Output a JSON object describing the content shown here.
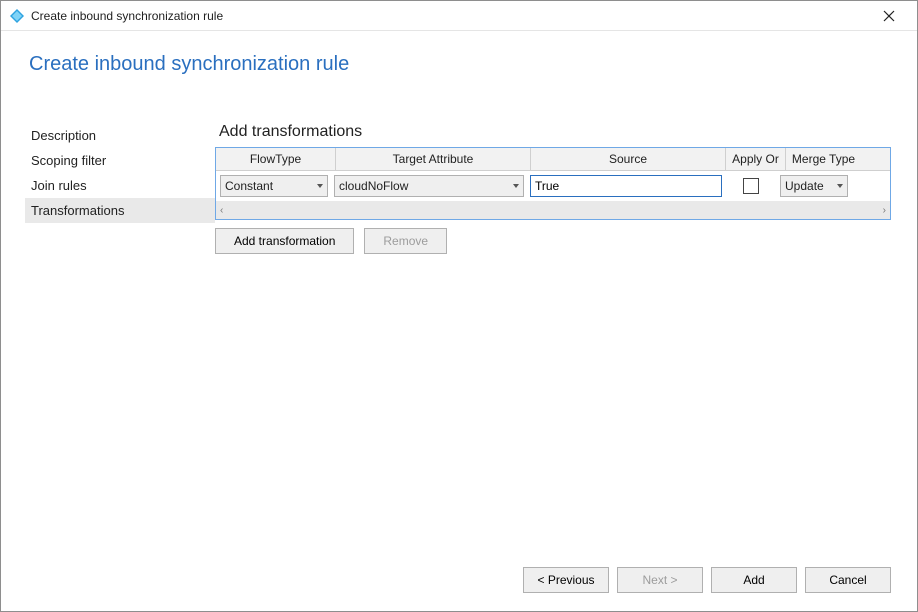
{
  "window": {
    "title": "Create inbound synchronization rule"
  },
  "page": {
    "title": "Create inbound synchronization rule"
  },
  "sidebar": {
    "items": [
      {
        "label": "Description",
        "selected": false
      },
      {
        "label": "Scoping filter",
        "selected": false
      },
      {
        "label": "Join rules",
        "selected": false
      },
      {
        "label": "Transformations",
        "selected": true
      }
    ]
  },
  "main": {
    "section_title": "Add transformations",
    "columns": {
      "flow_type": "FlowType",
      "target_attribute": "Target Attribute",
      "source": "Source",
      "apply_once": "Apply Or",
      "merge_type": "Merge Type"
    },
    "row": {
      "flow_type_value": "Constant",
      "target_attribute_value": "cloudNoFlow",
      "source_value": "True",
      "apply_once_checked": false,
      "merge_type_value": "Update"
    },
    "buttons": {
      "add_transformation": "Add transformation",
      "remove": "Remove"
    }
  },
  "footer": {
    "previous": "< Previous",
    "next": "Next >",
    "add": "Add",
    "cancel": "Cancel"
  }
}
